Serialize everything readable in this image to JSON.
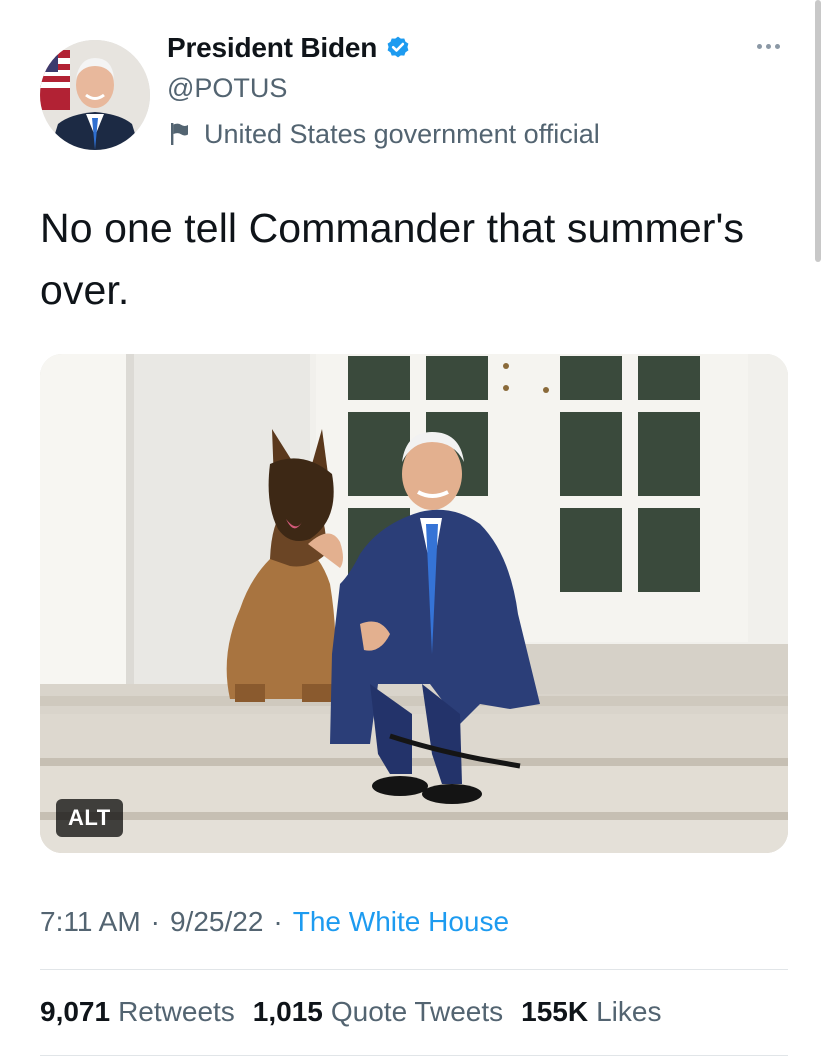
{
  "tweet": {
    "author": {
      "display_name": "President Biden",
      "handle": "@POTUS",
      "affiliation_label": "United States government official",
      "verified": true,
      "avatar_icon": "avatar-photo"
    },
    "text": "No one tell Commander that summer's over.",
    "media": {
      "alt_badge": "ALT",
      "description_icon": "photo"
    },
    "meta": {
      "time": "7:11 AM",
      "separator": "·",
      "date": "9/25/22",
      "source": "The White House"
    },
    "stats": [
      {
        "count": "9,071",
        "label": "Retweets"
      },
      {
        "count": "1,015",
        "label": "Quote Tweets"
      },
      {
        "count": "155K",
        "label": "Likes"
      }
    ]
  },
  "colors": {
    "text_primary": "#0f1419",
    "text_secondary": "#536471",
    "link": "#1d9bf0",
    "verified_badge": "#1d9bf0"
  }
}
